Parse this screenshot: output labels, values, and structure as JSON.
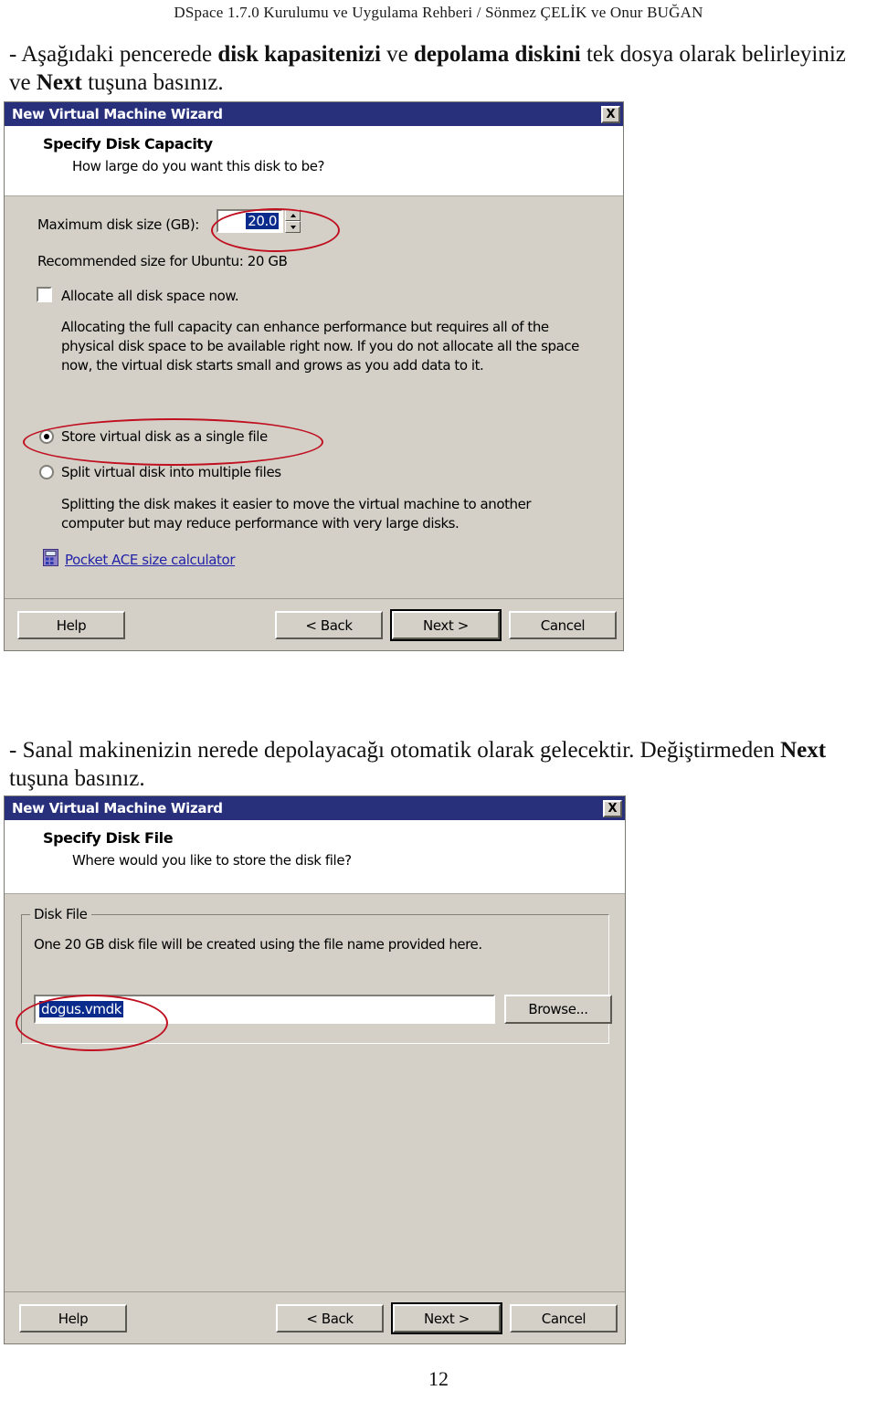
{
  "document": {
    "running_header": "DSpace 1.7.0  Kurulumu ve Uygulama Rehberi / Sönmez ÇELİK ve Onur BUĞAN",
    "page_number": "12",
    "paragraph_1": {
      "part1": "- Aşağıdaki pencerede ",
      "bold1": "disk kapasitenizi",
      "part2": " ve ",
      "bold2": "depolama diskini",
      "part3": " tek dosya olarak belirleyiniz  ve ",
      "bold3": "Next",
      "part4": " tuşuna basınız."
    },
    "paragraph_2": {
      "part1": "- Sanal makinenizin nerede depolayacağı otomatik olarak gelecektir. Değiştirmeden ",
      "bold1": "Next",
      "part2": " tuşuna basınız."
    }
  },
  "colors": {
    "titlebar": "#28307c",
    "dialog_face": "#d4d0c8",
    "selection": "#0a2a8c",
    "annotation": "#c01020",
    "link": "#2222a8"
  },
  "dialog1": {
    "title": "New Virtual Machine Wizard",
    "close_label": "X",
    "heading": "Specify Disk Capacity",
    "subheading": "How large do you want this disk to be?",
    "max_disk_label": "Maximum disk size (GB):",
    "max_disk_value": "20.0",
    "recommended_text": "Recommended size for Ubuntu: 20 GB",
    "allocate_label": "Allocate all disk space now.",
    "allocate_checked": false,
    "allocate_desc": "Allocating the full capacity can enhance performance but requires all of the physical disk space to be available right now. If you do not allocate all the space now, the virtual disk starts small and grows as you add data to it.",
    "radio_single": "Store virtual disk as a single file",
    "radio_split": "Split virtual disk into multiple files",
    "split_desc": "Splitting the disk makes it easier to move the virtual machine to another computer but may reduce performance with very large disks.",
    "link_label": "Pocket ACE size calculator",
    "buttons": {
      "help": "Help",
      "back": "< Back",
      "next": "Next >",
      "cancel": "Cancel"
    }
  },
  "dialog2": {
    "title": "New Virtual Machine Wizard",
    "close_label": "X",
    "heading": "Specify Disk File",
    "subheading": "Where would you like to store the disk file?",
    "group_title": "Disk File",
    "group_desc": "One 20 GB disk file will be created using the file name provided here.",
    "filename_value": "dogus.vmdk",
    "browse_label": "Browse...",
    "buttons": {
      "help": "Help",
      "back": "< Back",
      "next": "Next >",
      "cancel": "Cancel"
    }
  }
}
